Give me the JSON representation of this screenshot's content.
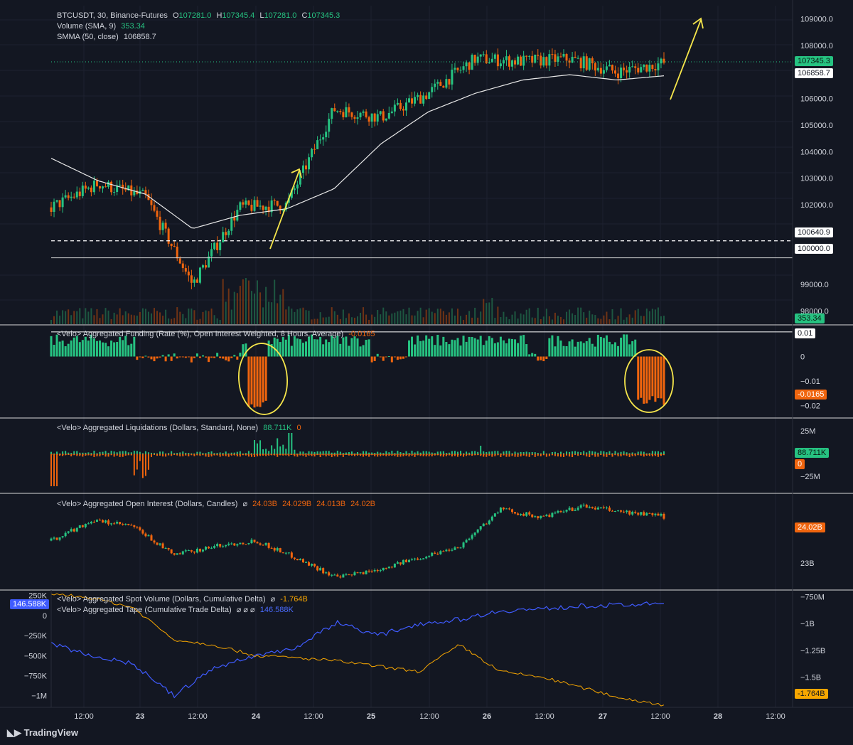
{
  "colors": {
    "background": "#131722",
    "up": "#26c281",
    "down": "#f0650e",
    "smma": "#e8e8e8",
    "annotation": "#f6e64b",
    "spot_delta": "#f7a600",
    "tape_delta": "#3f5bff",
    "grid": "#1e2230",
    "separator": "#d9d9d9"
  },
  "header": {
    "symbol": "BTCUSDT, 30, Binance-Futures",
    "o_label": "O",
    "o_value": "107281.0",
    "h_label": "H",
    "h_value": "107345.4",
    "l_label": "L",
    "l_value": "107281.0",
    "c_label": "C",
    "c_value": "107345.3",
    "volume_label": "Volume (SMA, 9)",
    "volume_value": "353.34",
    "smma_label": "SMMA (50, close)",
    "smma_value": "106858.7"
  },
  "panes": {
    "funding": {
      "title": "<Velo> Aggregated Funding (Rate (%), Open Interest Weighted, 8 Hours, Average)",
      "value": "-0.0165"
    },
    "liquidations": {
      "title": "<Velo> Aggregated Liquidations (Dollars, Standard, None)",
      "value_long": "88.711K",
      "value_short": "0"
    },
    "open_interest": {
      "title": "<Velo> Aggregated Open Interest (Dollars, Candles)",
      "symbol": "⌀",
      "o": "24.03B",
      "h": "24.029B",
      "l": "24.013B",
      "c": "24.02B"
    },
    "spot_volume": {
      "title": "<Velo> Aggregated Spot Volume (Dollars, Cumulative Delta)",
      "symbol": "⌀",
      "value": "-1.764B"
    },
    "tape": {
      "title": "<Velo> Aggregated Tape (Cumulative Trade Delta)",
      "symbols": "⌀ ⌀ ⌀",
      "value": "146.588K"
    }
  },
  "price_tags": {
    "last": "107345.3",
    "smma": "106858.7",
    "level_dashed": "100640.9",
    "level_solid": "100000.0",
    "volume": "353.34",
    "funding_ref": "0.01",
    "funding_last": "-0.0165",
    "liq_long": "88.711K",
    "liq_short": "0",
    "oi_last": "24.02B",
    "spot_last": "-1.764B",
    "tape_last": "146.588K"
  },
  "price_axis": [
    "109000.0",
    "108000.0",
    "107000.0",
    "106000.0",
    "105000.0",
    "104000.0",
    "103000.0",
    "102000.0",
    "101000.0",
    "99000.0",
    "98000.0"
  ],
  "funding_axis": [
    "0",
    "−0.01",
    "−0.02"
  ],
  "liq_axis": [
    "25M",
    "−25M"
  ],
  "oi_axis": [
    "23B"
  ],
  "spot_axis": [
    "−750M",
    "−1B",
    "−1.25B",
    "−1.5B"
  ],
  "tape_axis": [
    "250K",
    "0",
    "−250K",
    "−500K",
    "−750K",
    "−1M"
  ],
  "time_axis": [
    "12:00",
    "23",
    "12:00",
    "24",
    "12:00",
    "25",
    "12:00",
    "26",
    "12:00",
    "27",
    "12:00",
    "28",
    "12:00"
  ],
  "brand": "TradingView",
  "chart_data": {
    "type": "candlestick",
    "symbol": "BTCUSDT",
    "timeframe": "30",
    "exchange": "Binance-Futures",
    "ylim": [
      97500,
      109500
    ],
    "x": [
      "22 06:00",
      "22 18:00",
      "23 00:00",
      "23 12:00",
      "24 00:00",
      "24 06:00",
      "24 12:00",
      "25 00:00",
      "25 12:00",
      "26 00:00",
      "26 12:00",
      "27 00:00",
      "27 06:00",
      "27 12:00"
    ],
    "close": [
      101900,
      102800,
      102300,
      99000,
      101900,
      102000,
      105600,
      105300,
      106200,
      107500,
      107400,
      107500,
      107000,
      107345
    ],
    "smma": [
      103750,
      102900,
      102400,
      101100,
      101600,
      101850,
      102600,
      104300,
      105500,
      106200,
      106700,
      106900,
      106700,
      106859
    ],
    "levels": [
      100640.9,
      100000.0
    ],
    "funding": {
      "type": "bar",
      "ylim": [
        -0.025,
        0.012
      ],
      "last": -0.0165
    },
    "liquidations": {
      "type": "bar",
      "long_last": "88.711K",
      "short_last": "0"
    },
    "open_interest": {
      "type": "candlestick",
      "last": "24.02B",
      "ylim": [
        22.8,
        24.35
      ]
    },
    "spot_cumulative_delta": {
      "type": "line",
      "last": "-1.764B",
      "ylim": [
        -1.75,
        -0.7
      ]
    },
    "tape_cumulative_delta": {
      "type": "line",
      "last": "146.588K",
      "ylim": [
        -1100,
        300
      ]
    }
  }
}
